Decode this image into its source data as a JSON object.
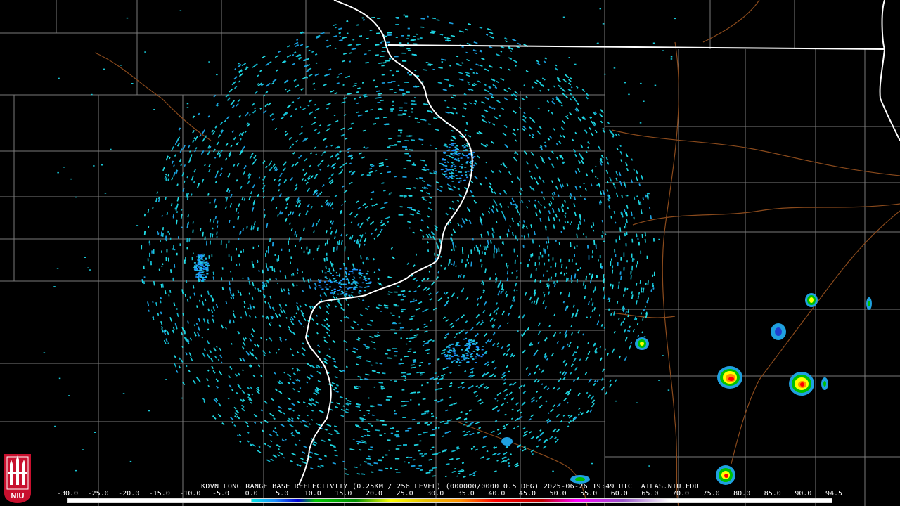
{
  "product": {
    "header": "KDVN LONG RANGE BASE REFLECTIVITY (0.25KM / 256 LEVEL) (000000/0000 0.5 DEG) 2025-06-26 19:49 UTC  ATLAS.NIU.EDU"
  },
  "logo": {
    "text": "NIU",
    "color": "#c8102e"
  },
  "scale": {
    "unit_ticks": [
      "-30.0",
      "-25.0",
      "-20.0",
      "-15.0",
      "-10.0",
      "-5.0",
      "0.0",
      "5.0",
      "10.0",
      "15.0",
      "20.0",
      "25.0",
      "30.0",
      "35.0",
      "40.0",
      "45.0",
      "50.0",
      "55.0",
      "60.0",
      "65.0",
      "70.0",
      "75.0",
      "80.0",
      "85.0",
      "90.0",
      "94.5"
    ],
    "colors": [
      "#ffffff",
      "#ffffff",
      "#ffffff",
      "#ffffff",
      "#ffffff",
      "#ffffff",
      "#00e5e5",
      "#1e90ff",
      "#0000d6",
      "#00c800",
      "#009000",
      "#006400",
      "#ffff00",
      "#e7c000",
      "#ff9000",
      "#ff0000",
      "#d60000",
      "#c00000",
      "#ff00ff",
      "#9955c9",
      "#ffffff",
      "#ffffff",
      "#ffffff",
      "#ffffff",
      "#ffffff"
    ]
  },
  "map": {
    "background": "#000000",
    "county_line_color": "#808080",
    "state_line_color": "#ffffff",
    "river_color": "#8b4513",
    "echo_color": "#18c8d8"
  }
}
